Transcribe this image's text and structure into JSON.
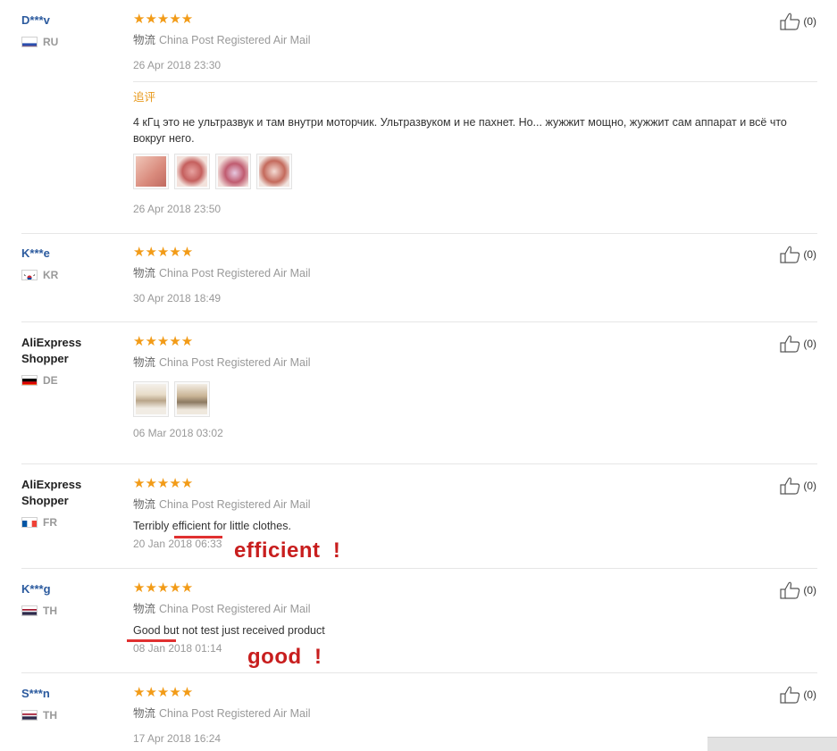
{
  "logistics_label": "物流",
  "star_glyph": "★★★★★",
  "accent_color": "#f29b17",
  "annotation_color": "#c81e1e",
  "reviews": [
    {
      "name": "D***v",
      "country": "RU",
      "stars": 5,
      "shipping": "China Post Registered Air Mail",
      "date": "26 Apr 2018 23:30",
      "likes": "(0)",
      "followup": {
        "label": "追评",
        "text": "4 кГц это не ультразвук и там внутри моторчик. Ультразвуком и не пахнет. Но... жужжит мощно, жужжит сам аппарат и всё что вокруг него.",
        "photos": [
          "product-photo-1",
          "product-photo-2",
          "product-photo-3",
          "product-photo-4"
        ],
        "date": "26 Apr 2018 23:50"
      }
    },
    {
      "name": "K***e",
      "country": "KR",
      "stars": 5,
      "shipping": "China Post Registered Air Mail",
      "date": "30 Apr 2018 18:49",
      "likes": "(0)"
    },
    {
      "name": "AliExpress\nShopper",
      "country": "DE",
      "stars": 5,
      "shipping": "China Post Registered Air Mail",
      "photos": [
        "product-photo-1",
        "product-photo-2"
      ],
      "date": "06 Mar 2018 03:02",
      "likes": "(0)"
    },
    {
      "name": "AliExpress\nShopper",
      "country": "FR",
      "stars": 5,
      "shipping": "China Post Registered Air Mail",
      "text": "Terribly efficient for little clothes.",
      "date": "20 Jan 2018 06:33",
      "likes": "(0)",
      "annotation": "efficient  !"
    },
    {
      "name": "K***g",
      "country": "TH",
      "stars": 5,
      "shipping": "China Post Registered Air Mail",
      "text": "Good but not test just received product",
      "date": "08 Jan 2018 01:14",
      "likes": "(0)",
      "annotation": "good  !"
    },
    {
      "name": "S***n",
      "country": "TH",
      "stars": 5,
      "shipping": "China Post Registered Air Mail",
      "date": "17 Apr 2018 16:24",
      "likes": "(0)"
    }
  ]
}
